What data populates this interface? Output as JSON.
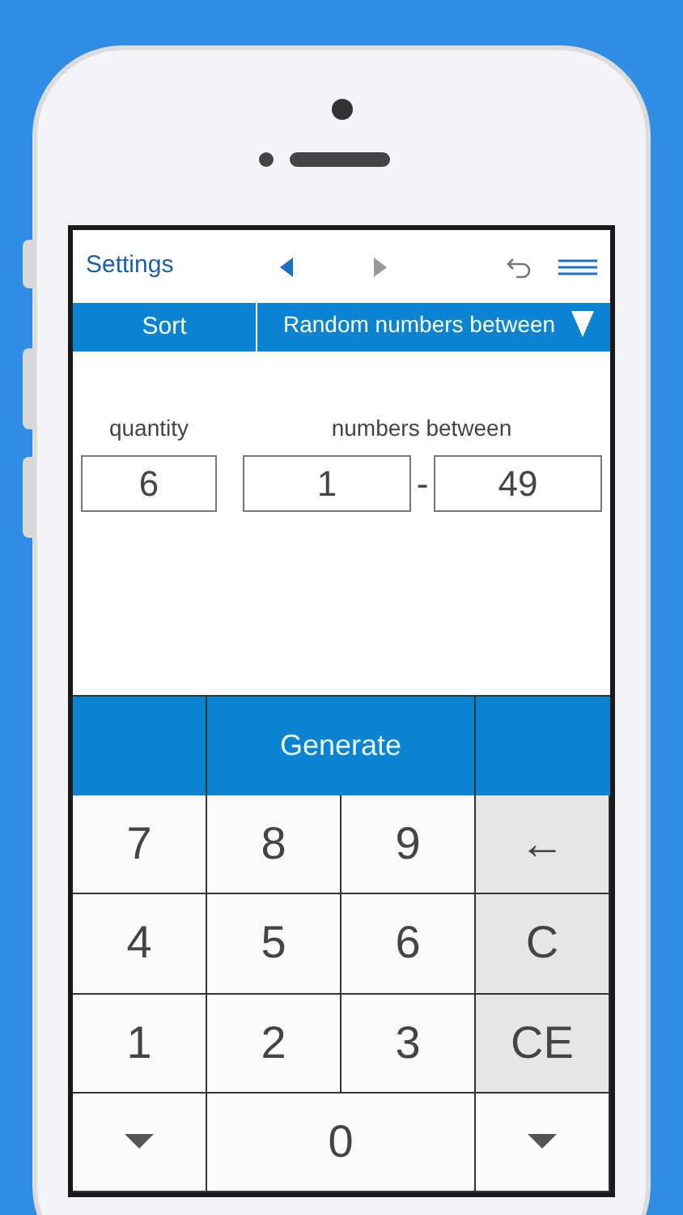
{
  "header": {
    "settings": "Settings",
    "back_disabled": false,
    "forward_disabled": true
  },
  "toolbar": {
    "sort": "Sort",
    "mode": "Random numbers between"
  },
  "fields": {
    "quantity_label": "quantity",
    "range_label": "numbers between",
    "quantity": "6",
    "from": "1",
    "separator": "-",
    "to": "49"
  },
  "generate": "Generate",
  "keys": [
    {
      "label": "7",
      "kind": "digit"
    },
    {
      "label": "8",
      "kind": "digit"
    },
    {
      "label": "9",
      "kind": "digit"
    },
    {
      "label": "←",
      "kind": "function"
    },
    {
      "label": "4",
      "kind": "digit"
    },
    {
      "label": "5",
      "kind": "digit"
    },
    {
      "label": "6",
      "kind": "digit"
    },
    {
      "label": "C",
      "kind": "function"
    },
    {
      "label": "1",
      "kind": "digit"
    },
    {
      "label": "2",
      "kind": "digit"
    },
    {
      "label": "3",
      "kind": "digit"
    },
    {
      "label": "CE",
      "kind": "function"
    },
    {
      "kind": "down"
    },
    {
      "label": "0",
      "kind": "digit",
      "wide": true
    },
    {
      "kind": "down"
    }
  ]
}
